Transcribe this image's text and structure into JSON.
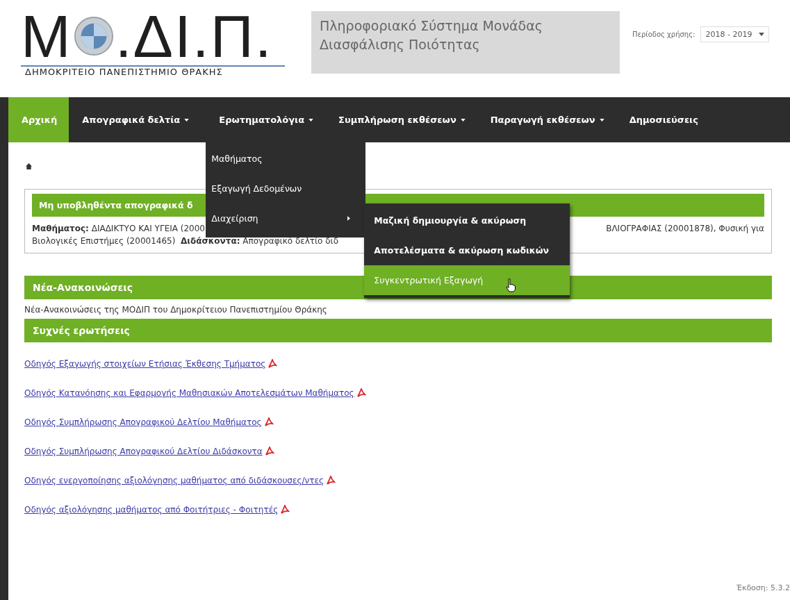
{
  "header": {
    "logo_letters": "Μ",
    "logo_rest": ".ΔΙ.Π.",
    "logo_subtitle": "ΔΗΜΟΚΡΙΤΕΙΟ ΠΑΝΕΠΙΣΤΗΜΙΟ ΘΡΑΚΗΣ",
    "system_title": "Πληροφοριακό Σύστημα Μονάδας Διασφάλισης Ποιότητας",
    "period_label": "Περίοδος χρήσης:",
    "period_value": "2018 - 2019"
  },
  "nav": [
    {
      "label": "Αρχική",
      "selected": true,
      "dropdown": false
    },
    {
      "label": "Απογραφικά δελτία",
      "selected": false,
      "dropdown": true
    },
    {
      "label": "Ερωτηματολόγια",
      "selected": false,
      "dropdown": true,
      "menu": [
        {
          "label": "Μαθήματος",
          "submenu": false
        },
        {
          "label": "Εξαγωγή Δεδομένων",
          "submenu": false
        },
        {
          "label": "Διαχείριση",
          "submenu": true,
          "children": [
            {
              "label": "Μαζική δημιουργία & ακύρωση",
              "selected": false
            },
            {
              "label": "Αποτελέσματα & ακύρωση κωδικών",
              "selected": false
            },
            {
              "label": "Συγκεντρωτική Εξαγωγή",
              "selected": true
            }
          ]
        }
      ]
    },
    {
      "label": "Συμπλήρωση εκθέσεων",
      "selected": false,
      "dropdown": true
    },
    {
      "label": "Παραγωγή εκθέσεων",
      "selected": false,
      "dropdown": true
    },
    {
      "label": "Δημοσιεύσεις",
      "selected": false,
      "dropdown": false
    }
  ],
  "pending": {
    "title": "Μη υποβληθέντα απογραφικά δ",
    "line1_start": "**Μαθήματος:** ΔΙΑΔΙΚΤΥΟ ΚΑΙ ΥΓΕΙΑ (2000",
    "line1_end": "ΒΛΙΟΓΡΑΦΙΑΣ (20001878), Φυσική για",
    "line2": "Βιολογικές Επιστήμες (20001465)  **Διδάσκοντα:** Απογραφικό δελτίο διδ"
  },
  "news": {
    "title": "Νέα-Ανακοινώσεις",
    "text": "Νέα-Ανακοινώσεις της ΜΟΔΙΠ του Δημοκρίτειου Πανεπιστημίου Θράκης"
  },
  "faq": {
    "title": "Συχνές ερωτήσεις",
    "links": [
      "Οδηγός Εξαγωγής στοιχείων Ετήσιας Έκθεσης Τμήματος",
      "Οδηγός Κατανόησης και Εφαρμογής Μαθησιακών Αποτελεσμάτων Μαθήματος",
      "Οδηγός Συμπλήρωσης Απογραφικού Δελτίου Μαθήματος",
      "Οδηγός Συμπλήρωσης Απογραφικού Δελτίου Διδάσκοντα",
      "Οδηγός ενεργοποίησης αξιολόγησης μαθήματος από διδάσκουσες/ντες",
      "Οδηγός αξιολόγησης μαθήματος από Φοιτήτριες - Φοιτητές"
    ]
  },
  "version": "Έκδοση: 5.3.2"
}
